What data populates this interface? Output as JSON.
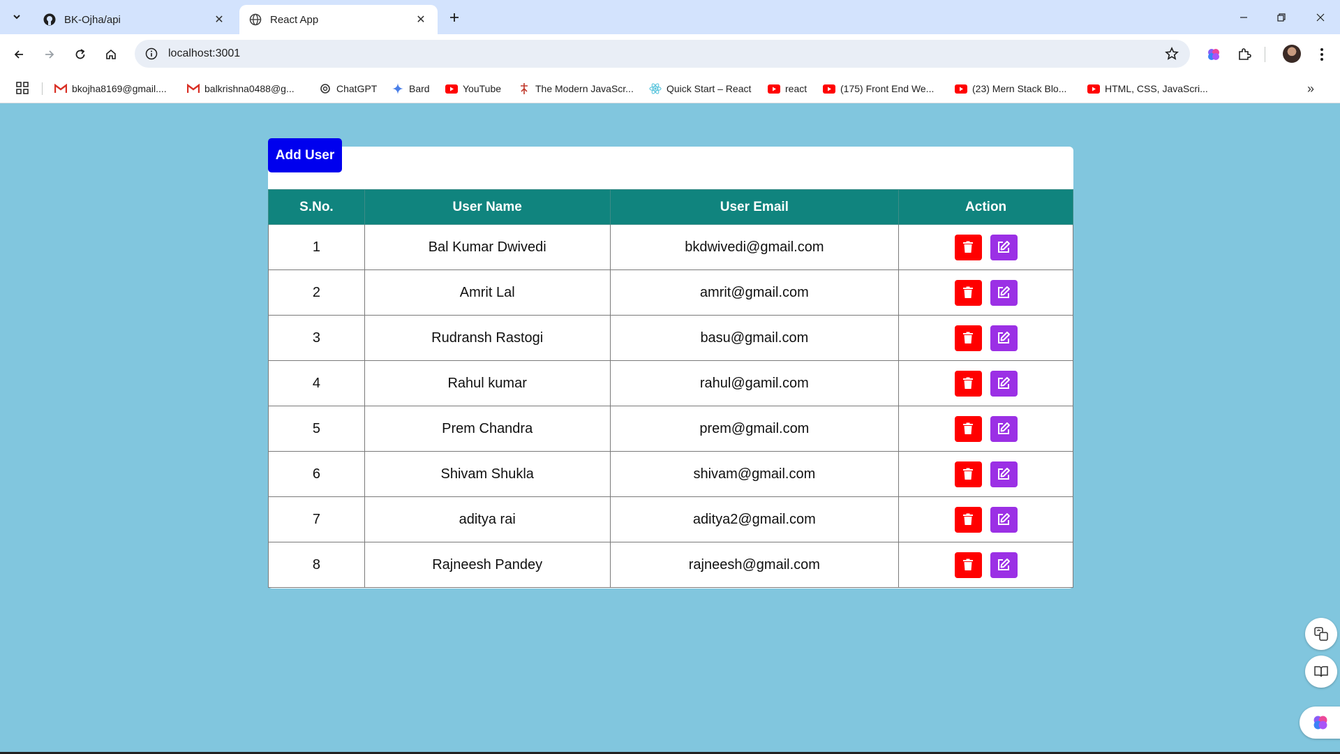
{
  "browser": {
    "tabs": [
      {
        "title": "BK-Ojha/api",
        "favicon": "github-icon",
        "active": false
      },
      {
        "title": "React App",
        "favicon": "globe-icon",
        "active": true
      }
    ],
    "address": "localhost:3001",
    "bookmarks": [
      {
        "label": "bkojha8169@gmail....",
        "icon": "gmail-icon"
      },
      {
        "label": "balkrishna0488@g...",
        "icon": "gmail-icon"
      },
      {
        "label": "ChatGPT",
        "icon": "chatgpt-icon"
      },
      {
        "label": "Bard",
        "icon": "bard-icon"
      },
      {
        "label": "YouTube",
        "icon": "youtube-icon"
      },
      {
        "label": "The Modern JavaScr...",
        "icon": "js-icon"
      },
      {
        "label": "Quick Start – React",
        "icon": "react-icon"
      },
      {
        "label": "react",
        "icon": "youtube-icon"
      },
      {
        "label": "(175) Front End We...",
        "icon": "youtube-icon"
      },
      {
        "label": "(23) Mern Stack Blo...",
        "icon": "youtube-icon"
      },
      {
        "label": "HTML, CSS, JavaScri...",
        "icon": "youtube-icon"
      }
    ],
    "bookmarks_more": "»"
  },
  "app": {
    "add_button_label": "Add User",
    "columns": [
      "S.No.",
      "User Name",
      "User Email",
      "Action"
    ],
    "colors": {
      "header": "#10847e",
      "delete": "#ff0000",
      "edit": "#9b30e5",
      "add": "#0000ee",
      "background": "#81c6de"
    },
    "users": [
      {
        "sno": "1",
        "name": "Bal Kumar Dwivedi",
        "email": "bkdwivedi@gmail.com"
      },
      {
        "sno": "2",
        "name": "Amrit Lal",
        "email": "amrit@gmail.com"
      },
      {
        "sno": "3",
        "name": "Rudransh Rastogi",
        "email": "basu@gmail.com"
      },
      {
        "sno": "4",
        "name": "Rahul kumar",
        "email": "rahul@gamil.com"
      },
      {
        "sno": "5",
        "name": "Prem Chandra",
        "email": "prem@gmail.com"
      },
      {
        "sno": "6",
        "name": "Shivam Shukla",
        "email": "shivam@gmail.com"
      },
      {
        "sno": "7",
        "name": "aditya rai",
        "email": "aditya2@gmail.com"
      },
      {
        "sno": "8",
        "name": "Rajneesh Pandey",
        "email": "rajneesh@gmail.com"
      }
    ]
  }
}
